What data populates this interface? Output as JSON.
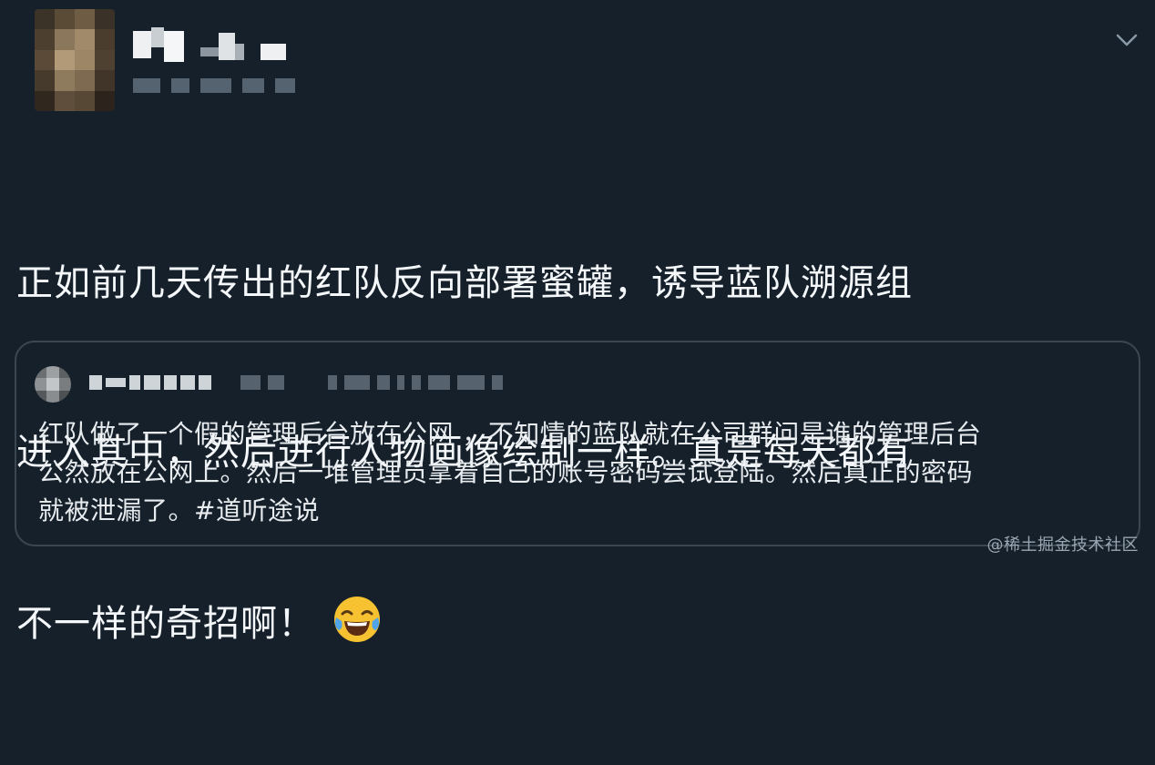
{
  "tweet": {
    "line1": "正如前几天传出的红队反向部署蜜罐，诱导蓝队溯源组",
    "line2": "进入其中，然后进行人物画像绘制一样。真是每天都有",
    "line3": "不一样的奇招啊！",
    "emoji": "face-with-tears-of-joy-icon"
  },
  "quoted_tweet": {
    "line1": "红队做了一个假的管理后台放在公网 ，不知情的蓝队就在公司群问是谁的管理后台",
    "line2": "公然放在公网上。然后一堆管理员拿着自己的账号密码尝试登陆。然后真正的密码",
    "line3": "就被泄漏了。#道听途说"
  },
  "watermark": "@稀土掘金技术社区",
  "colors": {
    "background": "#15202b",
    "text": "#f5f8fa",
    "quote_border": "#3a4753",
    "muted": "#8899a6"
  }
}
